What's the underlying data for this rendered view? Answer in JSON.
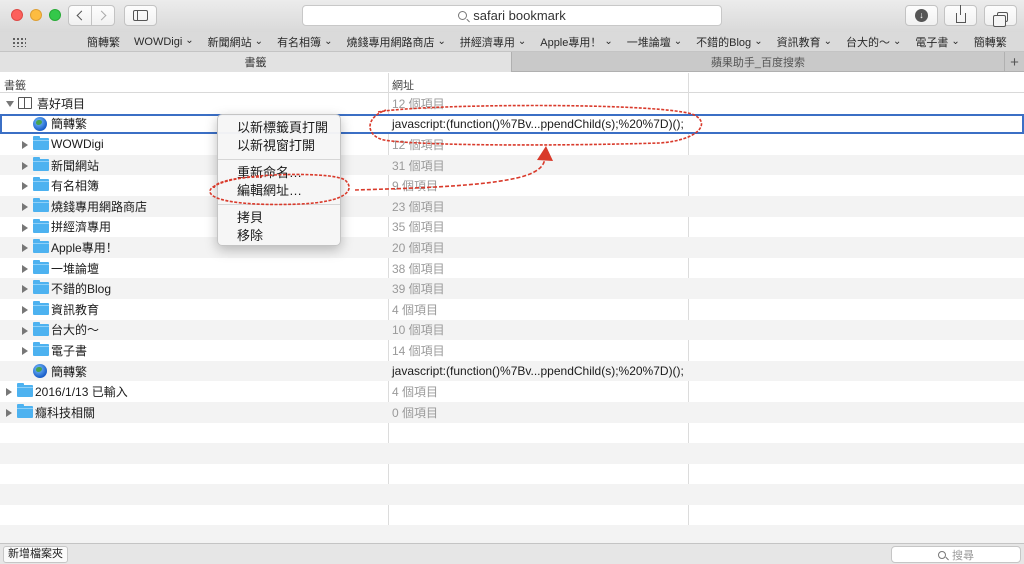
{
  "toolbar": {
    "address": "safari bookmark"
  },
  "favorites_bar": [
    {
      "label": "簡轉繁",
      "folder": false
    },
    {
      "label": "WOWDigi",
      "folder": true
    },
    {
      "label": "新聞網站",
      "folder": true
    },
    {
      "label": "有名相簿",
      "folder": true
    },
    {
      "label": "燒錢專用網路商店",
      "folder": true
    },
    {
      "label": "拼經濟專用",
      "folder": true
    },
    {
      "label": "Apple專用！",
      "folder": true
    },
    {
      "label": "一堆論壇",
      "folder": true
    },
    {
      "label": "不錯的Blog",
      "folder": true
    },
    {
      "label": "資訊教育",
      "folder": true
    },
    {
      "label": "台大的～",
      "folder": true
    },
    {
      "label": "電子書",
      "folder": true
    },
    {
      "label": "簡轉繁",
      "folder": false
    }
  ],
  "tabs": {
    "bookmarks": "書籤",
    "baidu": "蘋果助手_百度搜索",
    "new_tab": "+"
  },
  "columns": {
    "name": "書籤",
    "address": "網址"
  },
  "rows": [
    {
      "level": 0,
      "type": "root",
      "name": "喜好項目",
      "value": "12 個項目",
      "disclosure": "open"
    },
    {
      "level": 1,
      "type": "bookmark",
      "name": "簡轉繁",
      "value": "javascript:(function()%7Bv...ppendChild(s);%20%7D)();",
      "selected": true
    },
    {
      "level": 1,
      "type": "folder",
      "name": "WOWDigi",
      "value": "12 個項目"
    },
    {
      "level": 1,
      "type": "folder",
      "name": "新聞網站",
      "value": "31 個項目"
    },
    {
      "level": 1,
      "type": "folder",
      "name": "有名相簿",
      "value": "9 個項目"
    },
    {
      "level": 1,
      "type": "folder",
      "name": "燒錢專用網路商店",
      "value": "23 個項目"
    },
    {
      "level": 1,
      "type": "folder",
      "name": "拼經濟專用",
      "value": "35 個項目"
    },
    {
      "level": 1,
      "type": "folder",
      "name": "Apple專用！",
      "value": "20 個項目"
    },
    {
      "level": 1,
      "type": "folder",
      "name": "一堆論壇",
      "value": "38 個項目"
    },
    {
      "level": 1,
      "type": "folder",
      "name": "不錯的Blog",
      "value": "39 個項目"
    },
    {
      "level": 1,
      "type": "folder",
      "name": "資訊教育",
      "value": "4 個項目"
    },
    {
      "level": 1,
      "type": "folder",
      "name": "台大的～",
      "value": "10 個項目"
    },
    {
      "level": 1,
      "type": "folder",
      "name": "電子書",
      "value": "14 個項目"
    },
    {
      "level": 1,
      "type": "bookmark",
      "name": "簡轉繁",
      "value": "javascript:(function()%7Bv...ppendChild(s);%20%7D)();"
    },
    {
      "level": 0,
      "type": "folder",
      "name": "2016/1/13 已輸入",
      "value": "4 個項目"
    },
    {
      "level": 0,
      "type": "folder",
      "name": "癮科技相關",
      "value": "0 個項目"
    }
  ],
  "context_menu": {
    "open_new_tab": "以新標籤頁打開",
    "open_new_window": "以新視窗打開",
    "rename": "重新命名…",
    "edit_address": "編輯網址…",
    "copy": "拷貝",
    "delete": "移除"
  },
  "bottom": {
    "new_folder": "新增檔案夾",
    "search_placeholder": "搜尋"
  },
  "colors": {
    "selection": "#3b6fc5",
    "folder": "#4db2f0",
    "annotation": "#d93a2b"
  }
}
